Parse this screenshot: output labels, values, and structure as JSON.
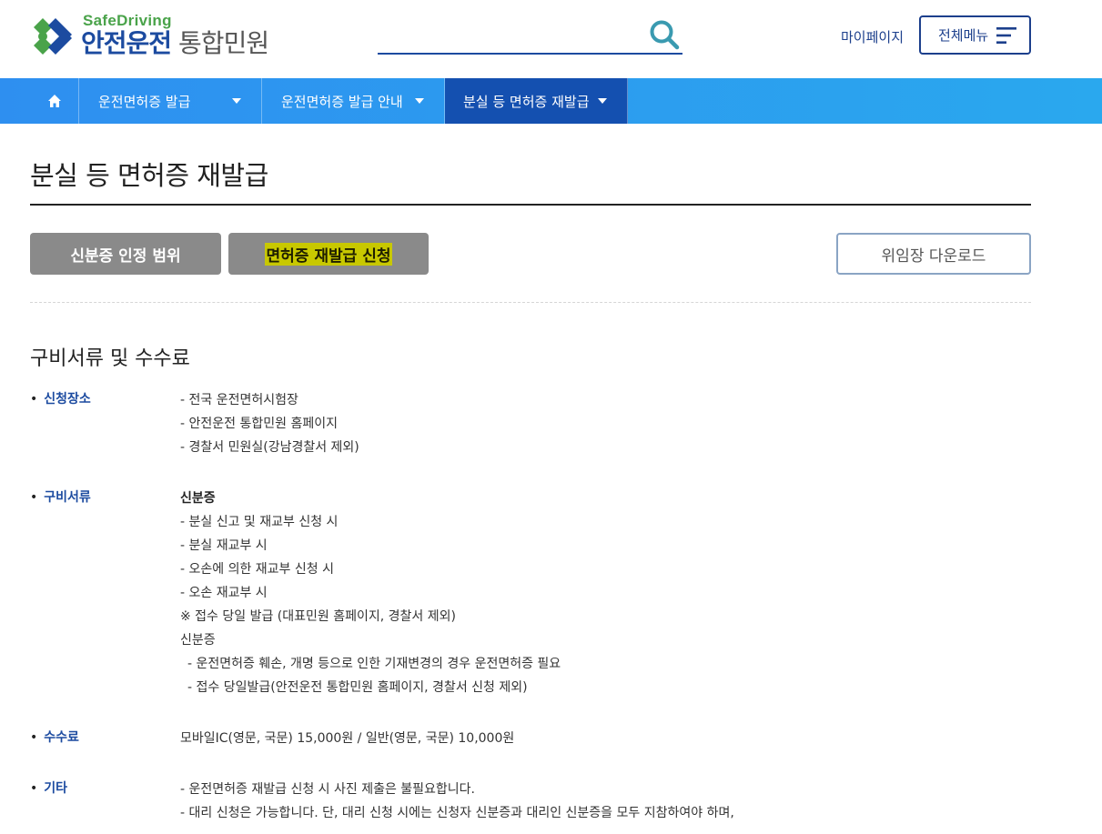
{
  "header": {
    "logo_sub": "SafeDriving",
    "logo_main": "안전운전",
    "logo_main_thin": "통합민원",
    "search_placeholder": "",
    "mypage_label": "마이페이지",
    "allmenu_label": "전체메뉴"
  },
  "nav": {
    "home_icon": "home-icon",
    "items": [
      {
        "label": "운전면허증 발급"
      },
      {
        "label": "운전면허증 발급 안내"
      },
      {
        "label": "분실 등 면허증 재발급",
        "active": true
      }
    ]
  },
  "page": {
    "title": "분실 등 면허증 재발급",
    "tabs": [
      {
        "label": "신분증 인정 범위"
      },
      {
        "label": "면허증 재발급 신청",
        "highlighted": true
      }
    ],
    "download_label": "위임장 다운로드"
  },
  "section": {
    "title": "구비서류 및 수수료",
    "rows": [
      {
        "label": "신청장소",
        "lines": [
          "- 전국 운전면허시험장",
          "- 안전운전 통합민원 홈페이지",
          "- 경찰서 민원실(강남경찰서 제외)"
        ]
      },
      {
        "label": "구비서류",
        "lines": [
          "신분증",
          "- 분실 신고 및 재교부 신청 시",
          "- 분실 재교부 시",
          "- 오손에 의한 재교부 신청 시",
          "- 오손 재교부 시",
          "※ 접수 당일 발급 (대표민원 홈페이지, 경찰서 제외)",
          "신분증",
          "- 운전면허증 훼손, 개명 등으로 인한 기재변경의 경우 운전면허증 필요",
          "- 접수 당일발급(안전운전 통합민원 홈페이지, 경찰서 신청 제외)"
        ]
      },
      {
        "label": "수수료",
        "lines": [
          "모바일IC(영문, 국문) 15,000원 / 일반(영문, 국문) 10,000원"
        ]
      },
      {
        "label": "기타",
        "lines": [
          "- 운전면허증 재발급 신청 시 사진 제출은 불필요합니다.",
          "- 대리 신청은 가능합니다. 단, 대리 신청 시에는 신청자 신분증과 대리인 신분증을 모두 지참하여야 하며,"
        ]
      }
    ]
  },
  "colors": {
    "brand_blue": "#1c4ba0",
    "nav_blue": "#2e8ff0",
    "nav_active": "#1450b0",
    "logo_green": "#4aa34a",
    "highlight": "#c8c800"
  }
}
